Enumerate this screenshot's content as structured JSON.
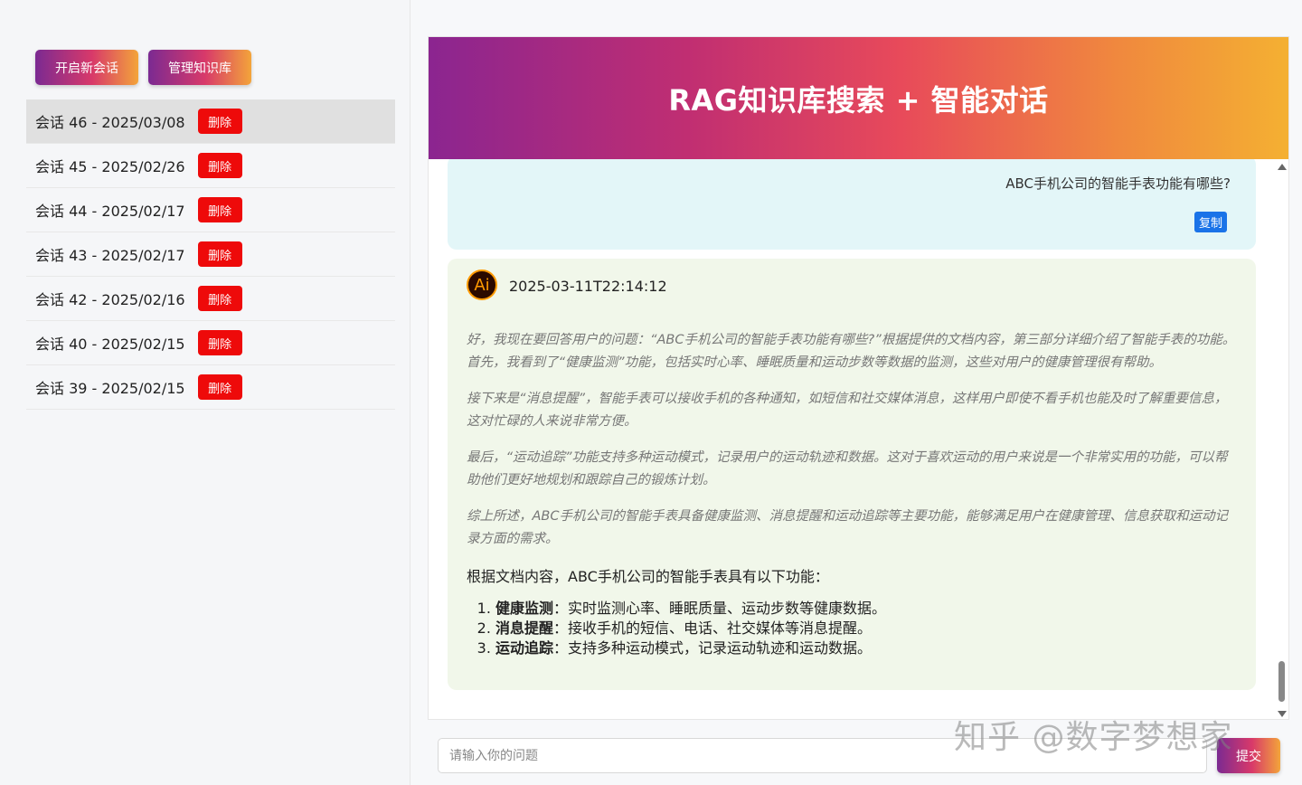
{
  "sidebar": {
    "new_session_label": "开启新会话",
    "manage_kb_label": "管理知识库",
    "sessions": [
      {
        "label": "会话 46 - 2025/03/08",
        "delete_label": "删除"
      },
      {
        "label": "会话 45 - 2025/02/26",
        "delete_label": "删除"
      },
      {
        "label": "会话 44 - 2025/02/17",
        "delete_label": "删除"
      },
      {
        "label": "会话 43 - 2025/02/17",
        "delete_label": "删除"
      },
      {
        "label": "会话 42 - 2025/02/16",
        "delete_label": "删除"
      },
      {
        "label": "会话 40 - 2025/02/15",
        "delete_label": "删除"
      },
      {
        "label": "会话 39 - 2025/02/15",
        "delete_label": "删除"
      }
    ]
  },
  "header": {
    "title": "RAG知识库搜索 + 智能对话"
  },
  "chat": {
    "user_message": "ABC手机公司的智能手表功能有哪些?",
    "copy_label": "复制",
    "ai_avatar_text": "Ai",
    "ai_timestamp": "2025-03-11T22:14:12",
    "think": [
      "好，我现在要回答用户的问题：“ABC手机公司的智能手表功能有哪些?”根据提供的文档内容，第三部分详细介绍了智能手表的功能。首先，我看到了“健康监测”功能，包括实时心率、睡眠质量和运动步数等数据的监测，这些对用户的健康管理很有帮助。",
      "接下来是“消息提醒”，智能手表可以接收手机的各种通知，如短信和社交媒体消息，这样用户即使不看手机也能及时了解重要信息，这对忙碌的人来说非常方便。",
      "最后，“运动追踪”功能支持多种运动模式，记录用户的运动轨迹和数据。这对于喜欢运动的用户来说是一个非常实用的功能，可以帮助他们更好地规划和跟踪自己的锻炼计划。",
      "综上所述，ABC手机公司的智能手表具备健康监测、消息提醒和运动追踪等主要功能，能够满足用户在健康管理、信息获取和运动记录方面的需求。"
    ],
    "answer_intro": "根据文档内容，ABC手机公司的智能手表具有以下功能：",
    "answer_items": [
      {
        "title": "健康监测",
        "desc": "：实时监测心率、睡眠质量、运动步数等健康数据。"
      },
      {
        "title": "消息提醒",
        "desc": "：接收手机的短信、电话、社交媒体等消息提醒。"
      },
      {
        "title": "运动追踪",
        "desc": "：支持多种运动模式，记录运动轨迹和运动数据。"
      }
    ]
  },
  "input": {
    "placeholder": "请输入你的问题",
    "submit_label": "提交"
  },
  "watermark": "知乎 @数字梦想家"
}
